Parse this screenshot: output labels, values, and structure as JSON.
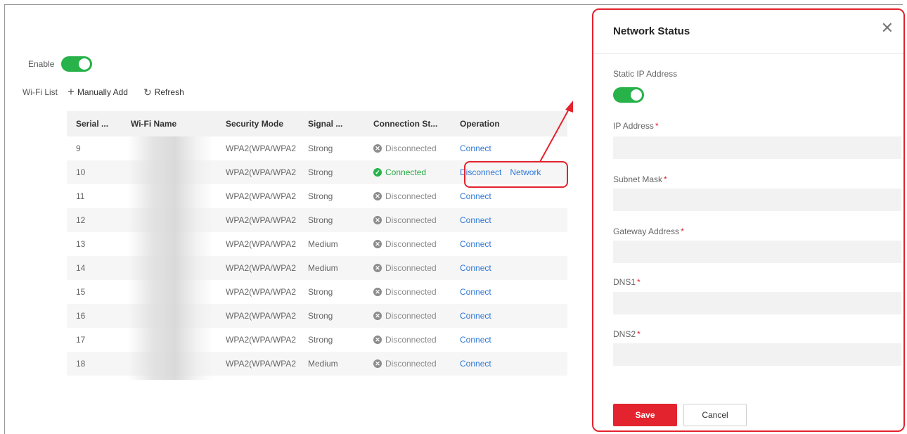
{
  "enable": {
    "label": "Enable",
    "state": true
  },
  "wifi_list": {
    "label": "Wi-Fi List",
    "manual_add": "Manually Add",
    "refresh": "Refresh"
  },
  "table": {
    "headers": [
      "Serial ...",
      "Wi-Fi Name",
      "Security Mode",
      "Signal ...",
      "Connection St...",
      "Operation"
    ],
    "rows": [
      {
        "serial": "9",
        "security": "WPA2(WPA/WPA2",
        "signal": "Strong",
        "status": "Disconnected",
        "connected": false,
        "ops": [
          "Connect"
        ]
      },
      {
        "serial": "10",
        "security": "WPA2(WPA/WPA2",
        "signal": "Strong",
        "status": "Connected",
        "connected": true,
        "ops": [
          "Disconnect",
          "Network"
        ]
      },
      {
        "serial": "11",
        "security": "WPA2(WPA/WPA2",
        "signal": "Strong",
        "status": "Disconnected",
        "connected": false,
        "ops": [
          "Connect"
        ]
      },
      {
        "serial": "12",
        "security": "WPA2(WPA/WPA2",
        "signal": "Strong",
        "status": "Disconnected",
        "connected": false,
        "ops": [
          "Connect"
        ]
      },
      {
        "serial": "13",
        "security": "WPA2(WPA/WPA2",
        "signal": "Medium",
        "status": "Disconnected",
        "connected": false,
        "ops": [
          "Connect"
        ]
      },
      {
        "serial": "14",
        "security": "WPA2(WPA/WPA2",
        "signal": "Medium",
        "status": "Disconnected",
        "connected": false,
        "ops": [
          "Connect"
        ]
      },
      {
        "serial": "15",
        "security": "WPA2(WPA/WPA2",
        "signal": "Strong",
        "status": "Disconnected",
        "connected": false,
        "ops": [
          "Connect"
        ]
      },
      {
        "serial": "16",
        "security": "WPA2(WPA/WPA2",
        "signal": "Strong",
        "status": "Disconnected",
        "connected": false,
        "ops": [
          "Connect"
        ]
      },
      {
        "serial": "17",
        "security": "WPA2(WPA/WPA2",
        "signal": "Strong",
        "status": "Disconnected",
        "connected": false,
        "ops": [
          "Connect"
        ]
      },
      {
        "serial": "18",
        "security": "WPA2(WPA/WPA2",
        "signal": "Medium",
        "status": "Disconnected",
        "connected": false,
        "ops": [
          "Connect"
        ]
      }
    ]
  },
  "panel": {
    "title": "Network Status",
    "static_ip_label": "Static IP Address",
    "static_ip_state": true,
    "fields": [
      {
        "label": "IP Address",
        "value": ""
      },
      {
        "label": "Subnet Mask",
        "value": ""
      },
      {
        "label": "Gateway Address",
        "value": ""
      },
      {
        "label": "DNS1",
        "value": ""
      },
      {
        "label": "DNS2",
        "value": ""
      }
    ],
    "required_mark": "*",
    "save": "Save",
    "cancel": "Cancel"
  },
  "colors": {
    "accent_red": "#e3232d",
    "toggle_green": "#27b24a",
    "link_blue": "#2f78d6"
  },
  "icons": {
    "add": "plus-icon",
    "refresh": "refresh-icon",
    "close": "close-icon",
    "status_ok": "check-circle-icon",
    "status_off": "x-circle-icon"
  }
}
